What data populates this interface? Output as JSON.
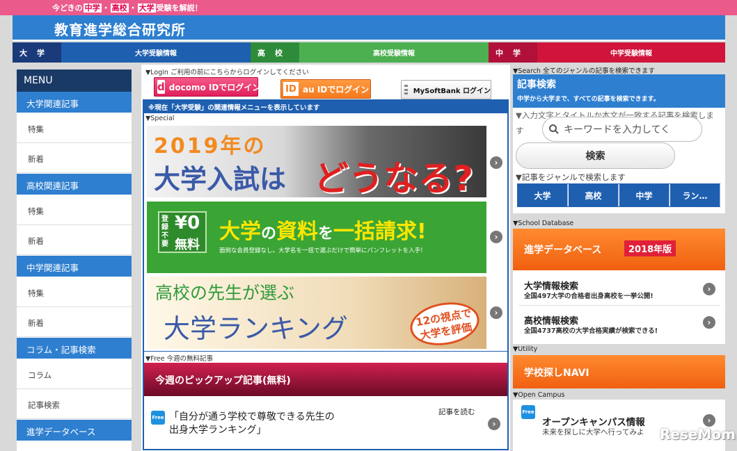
{
  "header": {
    "tagline_prefix": "今どきの",
    "tagline_hl1": "中学",
    "tagline_sep1": "・",
    "tagline_hl2": "高校",
    "tagline_sep2": "・",
    "tagline_hl3": "大学",
    "tagline_suffix": "受験を解説！",
    "site_title": "教育進学総合研究所"
  },
  "nav": [
    {
      "tag": "大学",
      "label": "大学受験情報",
      "tag_color": "#1a3a7a",
      "label_color": "#1e5fb0"
    },
    {
      "tag": "高校",
      "label": "高校受験情報",
      "tag_color": "#2e8b3a",
      "label_color": "#4caf50"
    },
    {
      "tag": "中学",
      "label": "中学受験情報",
      "tag_color": "#b0103a",
      "label_color": "#d0143c"
    }
  ],
  "menu": {
    "title": "MENU",
    "sections": [
      {
        "label": "大学関連記事",
        "items": [
          "特集",
          "新着"
        ]
      },
      {
        "label": "高校関連記事",
        "items": [
          "特集",
          "新着"
        ]
      },
      {
        "label": "中学関連記事",
        "items": [
          "特集",
          "新着"
        ]
      },
      {
        "label": "コラム・記事検索",
        "items": [
          "コラム",
          "記事検索"
        ]
      },
      {
        "label": "進学データベース",
        "items": []
      }
    ]
  },
  "login": {
    "header": "▼Login ご利用の前にこちらからログインしてください",
    "docomo_icon": "d",
    "docomo_label": "docomo IDでログイン",
    "au_icon": "ID",
    "au_label": "au IDでログイン",
    "softbank_label": "MySoftBank ログイン"
  },
  "special": {
    "notice": "※現在「大学受験」の関連情報メニューを表示しています",
    "header": "▼Special",
    "banner1_line1": "2019年の",
    "banner1_line2": "大学入試は",
    "banner1_line3": "どうなる?",
    "banner2_badge1": "登録不要",
    "banner2_badge2": "¥0",
    "banner2_badge3": "無料",
    "banner2_main1": "大学",
    "banner2_main2": "の",
    "banner2_main3": "資料",
    "banner2_main4": "を",
    "banner2_main5": "一括請求!",
    "banner2_sub": "面倒な会員登録なし。大学名を一括で選ぶだけで簡単にパンフレットを入手!",
    "banner3_line1": "高校の先生が選ぶ",
    "banner3_line2": "大学ランキング",
    "banner3_badge1": "12の視点で",
    "banner3_badge2": "大学を評価"
  },
  "free": {
    "header": "▼Free 今週の無料記事",
    "banner_title": "今週のピックアップ記事(無料)",
    "badge": "Free",
    "article_title": "「自分が通う学校で尊敬できる先生の出身大学ランキング」",
    "read_label": "記事を読む"
  },
  "search": {
    "header": "▼Search 全てのジャンルの記事を検索できます",
    "title": "記事検索",
    "subtitle": "中学から大学まで、すべての記事を検索できます。",
    "desc": "▼入力文字とタイトルか本文が一致する記事を検索します",
    "placeholder": "キーワードを入力してく",
    "button": "検索",
    "genre_label": "▼記事をジャンルで検索します",
    "genres": [
      "大学",
      "高校",
      "中学",
      "ラン…"
    ]
  },
  "school_db": {
    "header": "▼School Database",
    "banner_title": "進学データベース",
    "banner_badge": "2018年版",
    "links": [
      {
        "title": "大学情報検索",
        "desc": "全国497大学の合格者出身高校を一挙公開!"
      },
      {
        "title": "高校情報検索",
        "desc": "全国4737高校の大学合格実績が検索できる!"
      }
    ]
  },
  "utility": {
    "header": "▼Utility",
    "banner_title": "学校探しNAVI"
  },
  "open_campus": {
    "header": "▼Open Campus",
    "badge": "Free",
    "title": "オープンキャンパス情報",
    "desc": "未来を探しに大学へ行ってみよ"
  },
  "watermark": "ReseMom.",
  "colors": {
    "brand_blue": "#2e7fd0",
    "dark_navy": "#1a3a66",
    "pink": "#ea5a8a",
    "orange": "#f47a20"
  }
}
